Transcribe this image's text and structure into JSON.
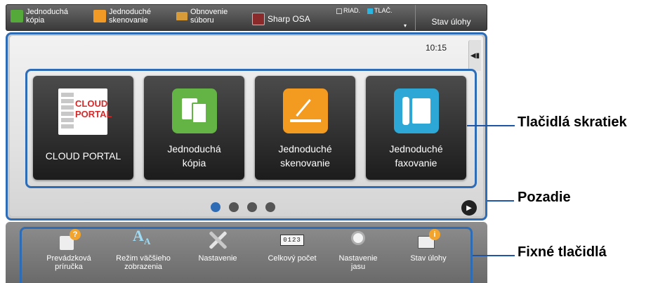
{
  "top_bar": {
    "items": [
      {
        "label_line1": "Jednoduchá",
        "label_line2": "kópia",
        "icon": "simple-copy-icon"
      },
      {
        "label_line1": "Jednoduché",
        "label_line2": "skenovanie",
        "icon": "simple-scan-icon"
      },
      {
        "label_line1": "Obnovenie",
        "label_line2": "súboru",
        "icon": "folder-icon"
      },
      {
        "label_line1": "Sharp OSA",
        "label_line2": "",
        "icon": "sharp-osa-icon"
      }
    ],
    "status_riad": "RIAD.",
    "status_tlac": "TLAČ.",
    "job_status": "Stav úlohy"
  },
  "main": {
    "clock": "10:15",
    "side_tab_icon": "collapse-arrow-icon",
    "tiles": [
      {
        "line1": "CLOUD PORTAL",
        "line2": "",
        "icon_text_1": "CLOUD",
        "icon_text_2": "PORTAL",
        "icon": "cloud-portal-icon"
      },
      {
        "line1": "Jednoduchá",
        "line2": "kópia",
        "icon": "copy-icon",
        "color": "#63b345"
      },
      {
        "line1": "Jednoduché",
        "line2": "skenovanie",
        "icon": "scan-icon",
        "color": "#f39a20"
      },
      {
        "line1": "Jednoduché",
        "line2": "faxovanie",
        "icon": "fax-icon",
        "color": "#2ca7d6"
      }
    ],
    "page_count": 4,
    "active_page": 1
  },
  "fixed_buttons": [
    {
      "line1": "Prevádzková",
      "line2": "príručka",
      "icon": "manual-help-icon"
    },
    {
      "line1": "Režim väčšieho",
      "line2": "zobrazenia",
      "icon": "large-text-icon"
    },
    {
      "line1": "Nastavenie",
      "line2": "",
      "icon": "settings-tools-icon"
    },
    {
      "line1": "Celkový počet",
      "line2": "",
      "icon": "counter-icon"
    },
    {
      "line1": "Nastavenie",
      "line2": "jasu",
      "icon": "brightness-icon"
    },
    {
      "line1": "Stav úlohy",
      "line2": "",
      "icon": "job-status-icon"
    }
  ],
  "callouts": {
    "shortcuts": "Tlačidlá skratiek",
    "background": "Pozadie",
    "fixed": "Fixné tlačidlá"
  },
  "colors": {
    "frame_blue": "#2f6cb6",
    "callout_line": "#1f55a5"
  }
}
